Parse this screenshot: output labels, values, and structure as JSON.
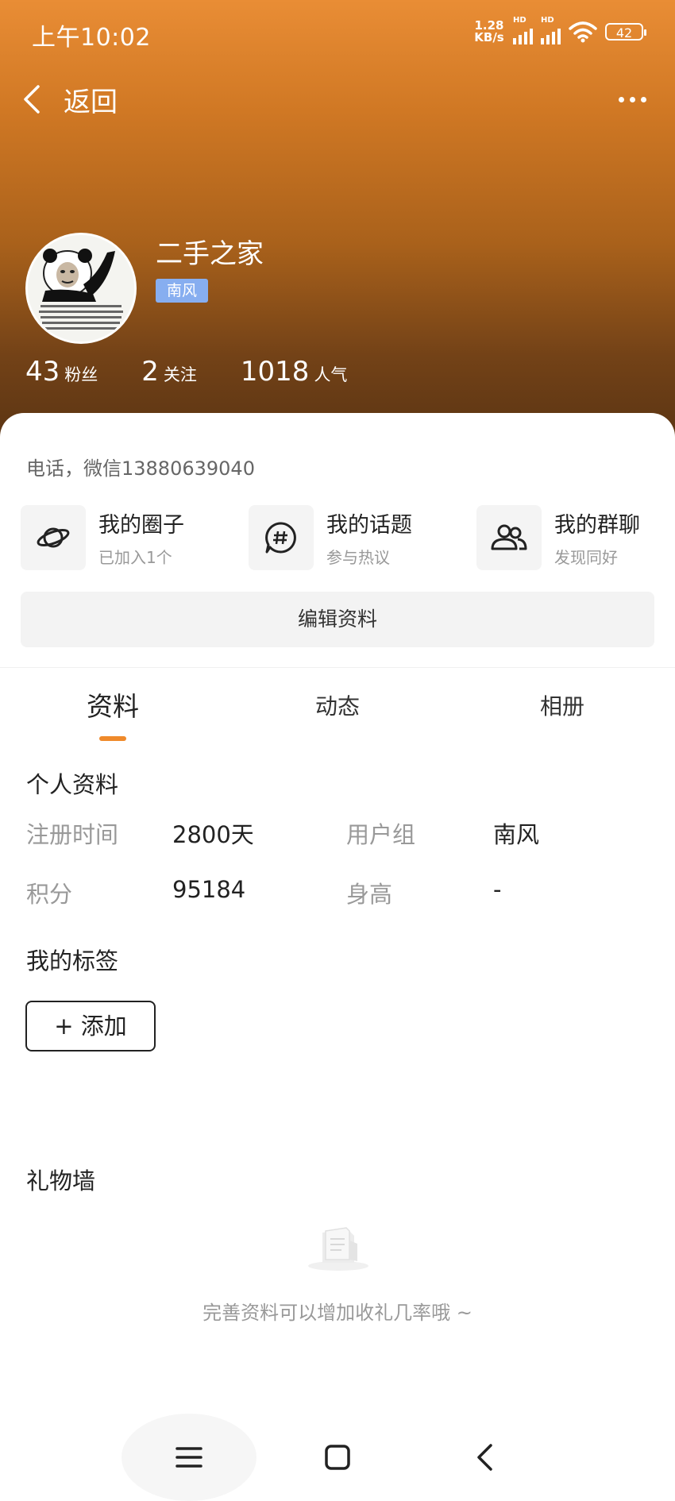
{
  "status_bar": {
    "time": "上午10:02",
    "net_speed_value": "1.28",
    "net_speed_unit": "KB/s",
    "signal1_label": "HD",
    "signal2_label": "HD",
    "battery": "42"
  },
  "nav": {
    "back_label": "返回",
    "icons": {
      "back": "chevron-left-icon",
      "more": "more-dots-icon"
    }
  },
  "profile": {
    "username": "二手之家",
    "group_badge": "南风",
    "contact": "电话，微信13880639040",
    "stats": [
      {
        "value": "43",
        "label": "粉丝"
      },
      {
        "value": "2",
        "label": "关注"
      },
      {
        "value": "1018",
        "label": "人气"
      }
    ]
  },
  "features": [
    {
      "title": "我的圈子",
      "subtitle": "已加入1个",
      "icon": "planet-icon"
    },
    {
      "title": "我的话题",
      "subtitle": "参与热议",
      "icon": "hashtag-bubble-icon"
    },
    {
      "title": "我的群聊",
      "subtitle": "发现同好",
      "icon": "group-users-icon"
    }
  ],
  "edit_button": "编辑资料",
  "tabs": [
    {
      "label": "资料",
      "active": true
    },
    {
      "label": "动态",
      "active": false
    },
    {
      "label": "相册",
      "active": false
    }
  ],
  "personal_info": {
    "title": "个人资料",
    "rows": [
      [
        {
          "label": "注册时间",
          "value": "2800天"
        },
        {
          "label": "用户组",
          "value": "南风"
        }
      ],
      [
        {
          "label": "积分",
          "value": "95184"
        },
        {
          "label": "身高",
          "value": "-"
        }
      ]
    ]
  },
  "tags": {
    "title": "我的标签",
    "add_button": "+ 添加"
  },
  "gifts": {
    "title": "礼物墙",
    "empty_text": "完善资料可以增加收礼几率哦 ~"
  },
  "colors": {
    "accent": "#ef8a2b",
    "badge": "#87aef0",
    "header_top": "#e98d35",
    "header_bottom": "#5a3413"
  }
}
